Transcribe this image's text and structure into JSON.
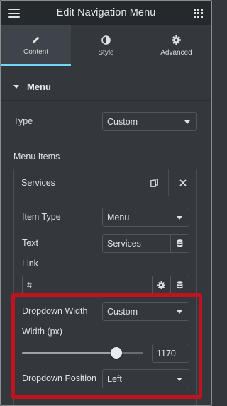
{
  "header": {
    "title": "Edit Navigation Menu"
  },
  "tabs": [
    {
      "label": "Content",
      "icon": "pencil-icon",
      "active": true
    },
    {
      "label": "Style",
      "icon": "half-circle-icon",
      "active": false
    },
    {
      "label": "Advanced",
      "icon": "gear-icon",
      "active": false
    }
  ],
  "section": {
    "title": "Menu"
  },
  "type_control": {
    "label": "Type",
    "value": "Custom"
  },
  "menu_items": {
    "label": "Menu Items",
    "item_title": "Services",
    "item_type": {
      "label": "Item Type",
      "value": "Menu"
    },
    "text": {
      "label": "Text",
      "value": "Services"
    },
    "link": {
      "label": "Link",
      "value": "#"
    },
    "dropdown_width": {
      "label": "Dropdown Width",
      "value": "Custom"
    },
    "width_px": {
      "label": "Width (px)",
      "value": "1170",
      "slider_fraction": 0.78
    },
    "dropdown_position": {
      "label": "Dropdown Position",
      "value": "Left"
    }
  },
  "colors": {
    "accent": "#71d7f7",
    "highlight": "#c1121f",
    "header_bg": "#26292c",
    "panel_bg": "#34383c"
  }
}
